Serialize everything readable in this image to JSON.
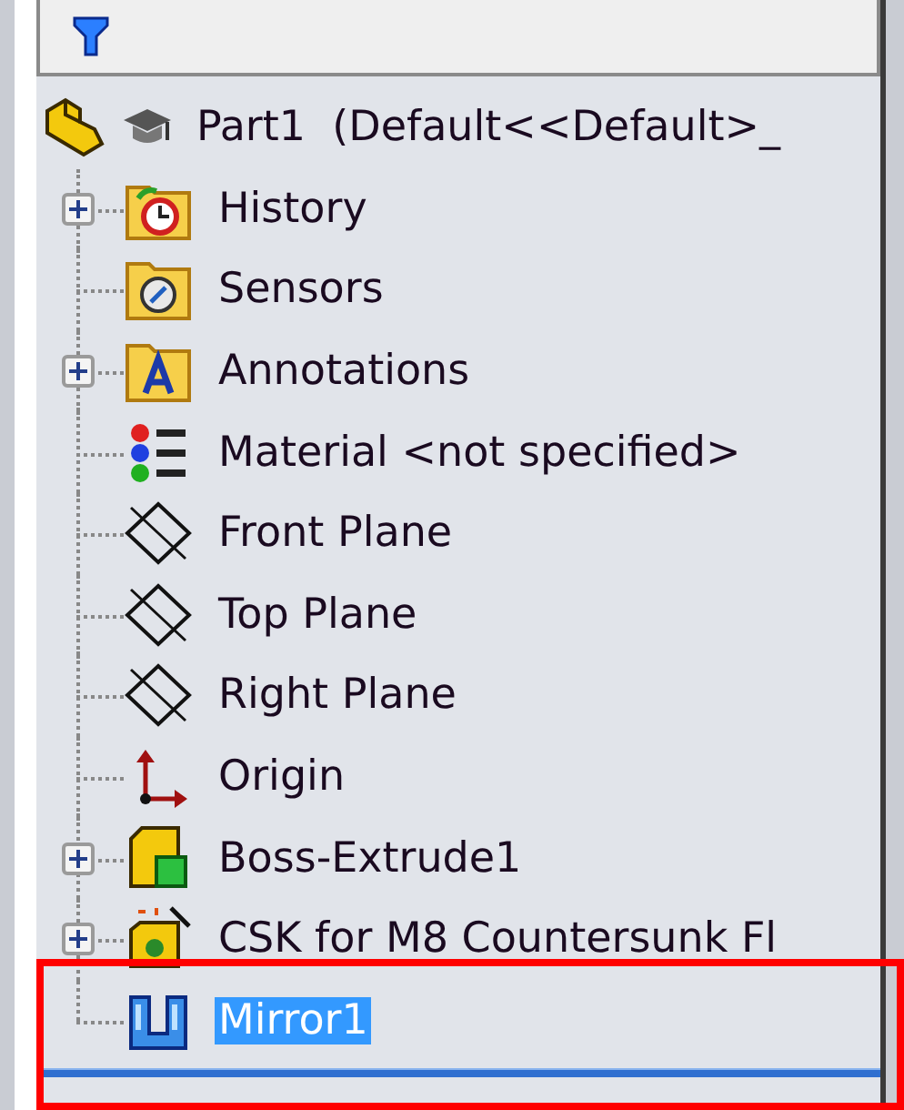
{
  "root": {
    "label": "Part1  (Default<<Default>_",
    "selected": false,
    "children": [
      {
        "kind": "history",
        "label": "History",
        "expanded": false,
        "selected": false
      },
      {
        "kind": "sensors",
        "label": "Sensors",
        "selected": false
      },
      {
        "kind": "annotations",
        "label": "Annotations",
        "expanded": false,
        "selected": false
      },
      {
        "kind": "material",
        "label": "Material <not specified>",
        "selected": false
      },
      {
        "kind": "plane",
        "label": "Front Plane",
        "selected": false
      },
      {
        "kind": "plane",
        "label": "Top Plane",
        "selected": false
      },
      {
        "kind": "plane",
        "label": "Right Plane",
        "selected": false
      },
      {
        "kind": "origin",
        "label": "Origin",
        "selected": false
      },
      {
        "kind": "extrude",
        "label": "Boss-Extrude1",
        "expanded": false,
        "selected": false
      },
      {
        "kind": "hole",
        "label": "CSK for M8 Countersunk Fl",
        "expanded": false,
        "selected": false
      },
      {
        "kind": "mirror",
        "label": "Mirror1",
        "selected": true
      }
    ]
  }
}
